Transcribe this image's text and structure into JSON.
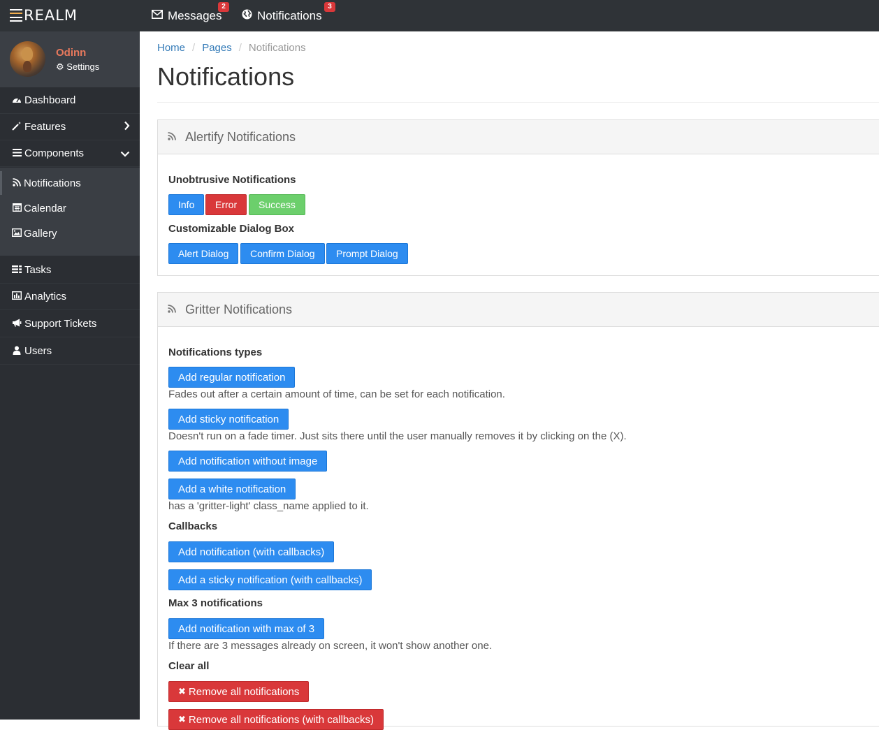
{
  "brand": {
    "name": "REALM"
  },
  "topnav": [
    {
      "label": "Messages",
      "icon": "envelope-icon",
      "badge": "2"
    },
    {
      "label": "Notifications",
      "icon": "globe-icon",
      "badge": "3"
    }
  ],
  "profile": {
    "name": "Odinn",
    "settings_label": "Settings"
  },
  "sidebar": {
    "items": [
      {
        "label": "Dashboard",
        "icon": "dashboard-icon"
      },
      {
        "label": "Features",
        "icon": "magic-wand-icon"
      },
      {
        "label": "Components",
        "icon": "bars-icon"
      }
    ],
    "subitems": [
      {
        "label": "Notifications",
        "icon": "rss-icon",
        "active": true
      },
      {
        "label": "Calendar",
        "icon": "calendar-icon"
      },
      {
        "label": "Gallery",
        "icon": "image-icon"
      }
    ],
    "items2": [
      {
        "label": "Tasks",
        "icon": "tasks-icon"
      },
      {
        "label": "Analytics",
        "icon": "bar-chart-icon"
      },
      {
        "label": "Support Tickets",
        "icon": "bullhorn-icon"
      },
      {
        "label": "Users",
        "icon": "user-icon"
      }
    ]
  },
  "breadcrumb": [
    "Home",
    "Pages",
    "Notifications"
  ],
  "page_title": "Notifications",
  "alertify": {
    "title": "Alertify Notifications",
    "unobtrusive_label": "Unobtrusive Notifications",
    "buttons1": [
      "Info",
      "Error",
      "Success"
    ],
    "dialog_label": "Customizable Dialog Box",
    "buttons2": [
      "Alert Dialog",
      "Confirm Dialog",
      "Prompt Dialog"
    ]
  },
  "gritter": {
    "title": "Gritter Notifications",
    "types_label": "Notifications types",
    "regular_btn": "Add regular notification",
    "regular_desc": "Fades out after a certain amount of time, can be set for each notification.",
    "sticky_btn": "Add sticky notification",
    "sticky_desc": "Doesn't run on a fade timer. Just sits there until the user manually removes it by clicking on the (X).",
    "noimage_btn": "Add notification without image",
    "white_btn": "Add a white notification",
    "white_desc": "has a 'gritter-light' class_name applied to it.",
    "callbacks_label": "Callbacks",
    "callbacks_btn": "Add notification (with callbacks)",
    "sticky_callbacks_btn": "Add a sticky notification (with callbacks)",
    "max_label": "Max 3 notifications",
    "max_btn": "Add notification with max of 3",
    "max_desc": "If there are 3 messages already on screen, it won't show another one.",
    "clear_label": "Clear all",
    "remove_btn": "Remove all notifications",
    "remove_callbacks_btn": "Remove all notifications (with callbacks)"
  },
  "colors": {
    "topbar": "#2f3337",
    "sidebar": "#2b2e33",
    "primary": "#2d8cf0",
    "danger": "#d9383a",
    "success": "#6ccf6c",
    "profile_name": "#e8795d"
  }
}
